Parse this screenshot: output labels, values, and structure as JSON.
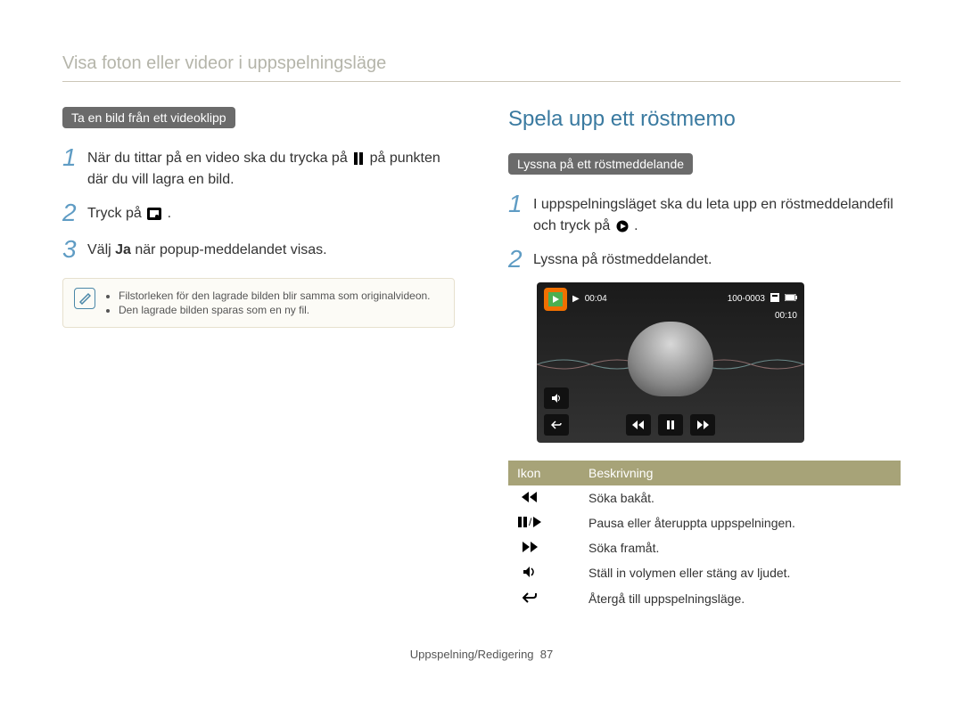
{
  "page_title": "Visa foton eller videor i uppspelningsläge",
  "left": {
    "chip": "Ta en bild från ett videoklipp",
    "step1_a": "När du tittar på en video ska du trycka på ",
    "step1_b": " på punkten där du vill lagra en bild.",
    "step2_a": "Tryck på ",
    "step2_b": ".",
    "step3_a": "Välj ",
    "step3_bold": "Ja",
    "step3_b": " när popup-meddelandet visas.",
    "note1": "Filstorleken för den lagrade bilden blir samma som originalvideon.",
    "note2": "Den lagrade bilden sparas som en ny fil."
  },
  "right": {
    "heading": "Spela upp ett röstmemo",
    "chip": "Lyssna på ett röstmeddelande",
    "step1_a": "I uppspelningsläget ska du leta upp en röstmeddelandefil och tryck på ",
    "step1_b": ".",
    "step2": "Lyssna på röstmeddelandet.",
    "player": {
      "elapsed": "00:04",
      "file_index": "100-0003",
      "total": "00:10"
    },
    "table": {
      "header_icon": "Ikon",
      "header_desc": "Beskrivning",
      "rows": [
        {
          "desc": "Söka bakåt."
        },
        {
          "desc": "Pausa eller återuppta uppspelningen."
        },
        {
          "desc": "Söka framåt."
        },
        {
          "desc": "Ställ in volymen eller stäng av ljudet."
        },
        {
          "desc": "Återgå till uppspelningsläge."
        }
      ]
    }
  },
  "footer": {
    "section": "Uppspelning/Redigering",
    "page": "87"
  }
}
